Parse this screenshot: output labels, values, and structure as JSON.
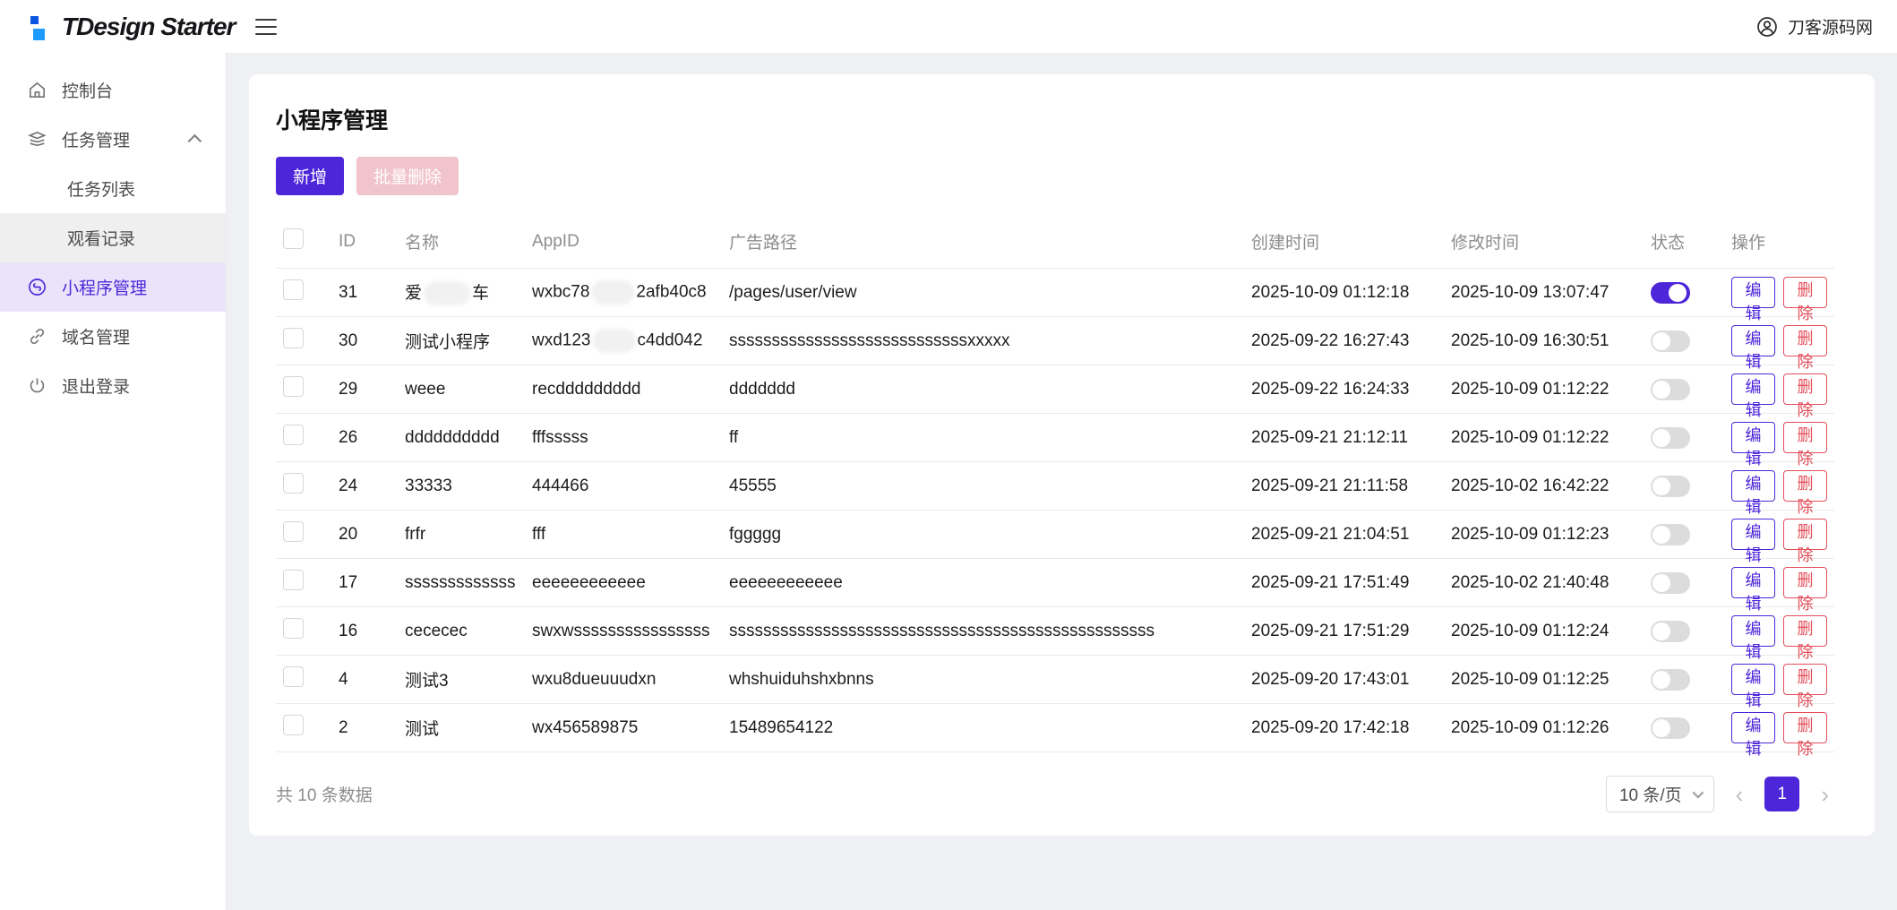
{
  "header": {
    "brand": "TDesign Starter",
    "user": "刀客源码网",
    "icons": {
      "brand": "tdesign-logo",
      "menu": "hamburger-icon",
      "user": "user-avatar-icon"
    }
  },
  "sidebar": {
    "items": [
      {
        "label": "控制台",
        "icon": "home-icon"
      },
      {
        "label": "任务管理",
        "icon": "layers-icon",
        "expanded": true
      },
      {
        "label": "任务列表",
        "parent": "任务管理"
      },
      {
        "label": "观看记录",
        "parent": "任务管理",
        "hovered": true
      },
      {
        "label": "小程序管理",
        "icon": "miniprogram-icon",
        "active": true
      },
      {
        "label": "域名管理",
        "icon": "link-icon"
      },
      {
        "label": "退出登录",
        "icon": "power-icon"
      }
    ]
  },
  "page": {
    "title": "小程序管理",
    "toolbar": {
      "add_label": "新增",
      "batch_delete_label": "批量删除"
    },
    "table": {
      "columns": [
        "ID",
        "名称",
        "AppID",
        "广告路径",
        "创建时间",
        "修改时间",
        "状态",
        "操作"
      ],
      "edit_label": "编辑",
      "delete_label": "删除",
      "rows": [
        {
          "id": "31",
          "name_pre": "爱",
          "name_masked": true,
          "name_suf": "车",
          "appid_pre": "wxbc78",
          "appid_masked": true,
          "appid_suf": "2afb40c8",
          "path": "/pages/user/view",
          "created": "2025-10-09 01:12:18",
          "modified": "2025-10-09 13:07:47",
          "status": true
        },
        {
          "id": "30",
          "name_pre": "测试小程序",
          "name_masked": false,
          "name_suf": "",
          "appid_pre": "wxd123",
          "appid_masked": true,
          "appid_suf": "c4dd042",
          "path": "ssssssssssssssssssssssssssssxxxxx",
          "created": "2025-09-22 16:27:43",
          "modified": "2025-10-09 16:30:51",
          "status": false
        },
        {
          "id": "29",
          "name_pre": "weee",
          "name_masked": false,
          "name_suf": "",
          "appid_pre": "recddddddddd",
          "appid_masked": false,
          "appid_suf": "",
          "path": "ddddddd",
          "created": "2025-09-22 16:24:33",
          "modified": "2025-10-09 01:12:22",
          "status": false
        },
        {
          "id": "26",
          "name_pre": "dddddddddd",
          "name_masked": false,
          "name_suf": "",
          "appid_pre": "fffsssss",
          "appid_masked": false,
          "appid_suf": "",
          "path": "ff",
          "created": "2025-09-21 21:12:11",
          "modified": "2025-10-09 01:12:22",
          "status": false
        },
        {
          "id": "24",
          "name_pre": "33333",
          "name_masked": false,
          "name_suf": "",
          "appid_pre": "444466",
          "appid_masked": false,
          "appid_suf": "",
          "path": "45555",
          "created": "2025-09-21 21:11:58",
          "modified": "2025-10-02 16:42:22",
          "status": false
        },
        {
          "id": "20",
          "name_pre": "frfr",
          "name_masked": false,
          "name_suf": "",
          "appid_pre": "fff",
          "appid_masked": false,
          "appid_suf": "",
          "path": "fggggg",
          "created": "2025-09-21 21:04:51",
          "modified": "2025-10-09 01:12:23",
          "status": false
        },
        {
          "id": "17",
          "name_pre": "sssssssssssss",
          "name_masked": false,
          "name_suf": "",
          "appid_pre": "eeeeeeeeeeee",
          "appid_masked": false,
          "appid_suf": "",
          "path": "eeeeeeeeeeee",
          "created": "2025-09-21 17:51:49",
          "modified": "2025-10-02 21:40:48",
          "status": false
        },
        {
          "id": "16",
          "name_pre": "cececec",
          "name_masked": false,
          "name_suf": "",
          "appid_pre": "swxwssssssssssssssss",
          "appid_masked": false,
          "appid_suf": "",
          "path": "ssssssssssssssssssssssssssssssssssssssssssssssssss",
          "created": "2025-09-21 17:51:29",
          "modified": "2025-10-09 01:12:24",
          "status": false
        },
        {
          "id": "4",
          "name_pre": "测试3",
          "name_masked": false,
          "name_suf": "",
          "appid_pre": "wxu8dueuuudxn",
          "appid_masked": false,
          "appid_suf": "",
          "path": "whshuiduhshxbnns",
          "created": "2025-09-20 17:43:01",
          "modified": "2025-10-09 01:12:25",
          "status": false
        },
        {
          "id": "2",
          "name_pre": "测试",
          "name_masked": false,
          "name_suf": "",
          "appid_pre": "wx456589875",
          "appid_masked": false,
          "appid_suf": "",
          "path": "15489654122",
          "created": "2025-09-20 17:42:18",
          "modified": "2025-10-09 01:12:26",
          "status": false
        }
      ]
    },
    "footer": {
      "total": "共 10 条数据",
      "page_size": "10 条/页",
      "current_page": "1",
      "icons": {
        "prev": "chevron-left-icon",
        "next": "chevron-right-icon",
        "size_select": "chevron-down-icon"
      }
    }
  },
  "colors": {
    "primary": "#4d26d9",
    "danger": "#e34d59",
    "disabled_pink": "#f1c3cb",
    "active_item_bg": "#eae4fb",
    "logo_blue_dark": "#0b55e0",
    "logo_blue_light": "#1e9bff",
    "page_bg": "#eef0f4"
  }
}
